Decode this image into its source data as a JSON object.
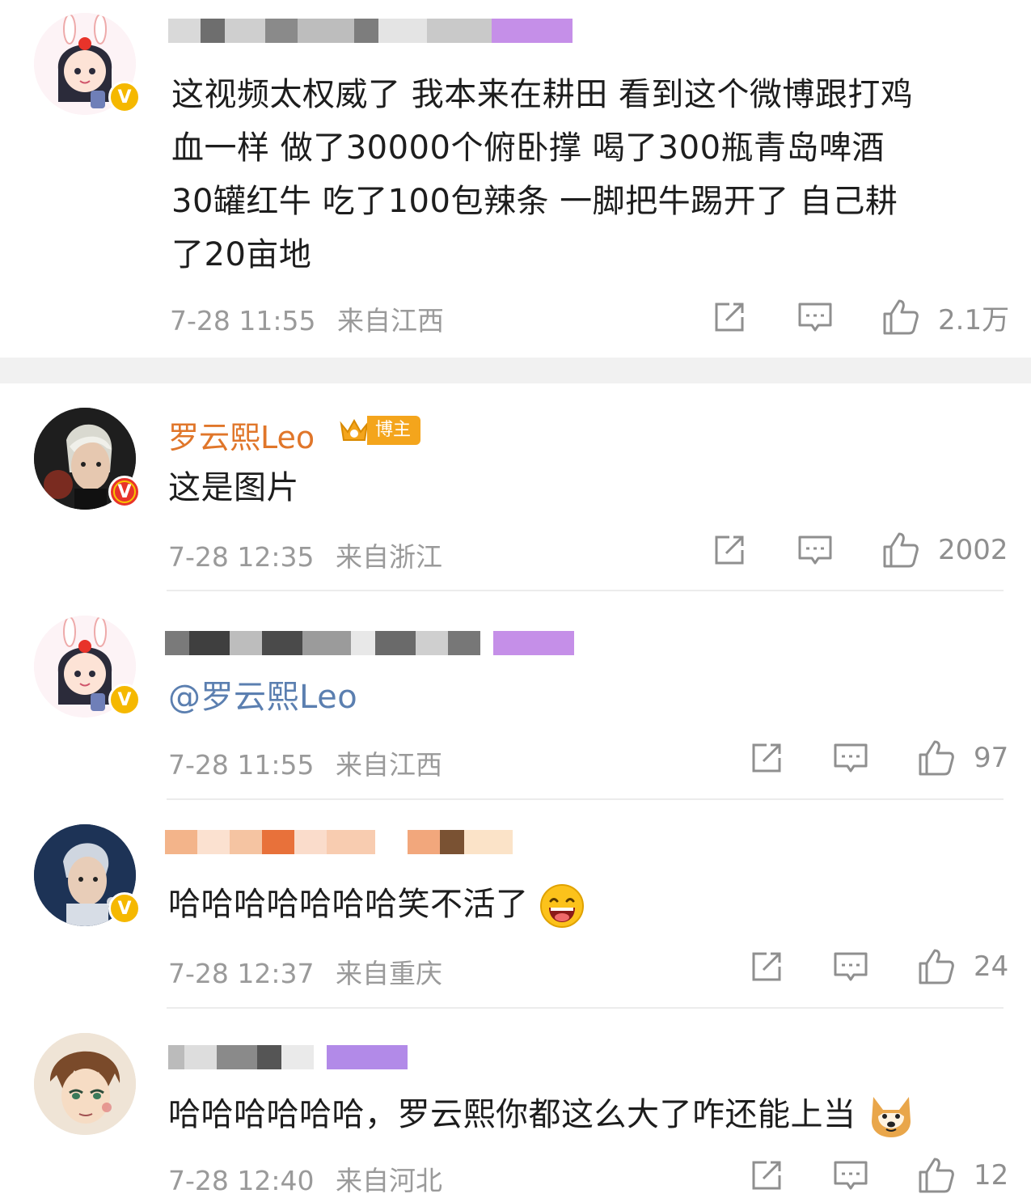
{
  "comments": [
    {
      "id": "c1",
      "text_lines": [
        "这视频太权威了 我本来在耕田 看到这个微博跟打鸡",
        "血一样 做了30000个俯卧撑 喝了300瓶青岛啤酒",
        " 30罐红牛 吃了100包辣条 一脚把牛踢开了 自己耕",
        "了20亩地"
      ],
      "time": "7-28 11:55",
      "location": "来自江西",
      "likes": "2.1万",
      "avatar_icon": "anime-girl-avatar",
      "badge": "gold-v-badge"
    },
    {
      "id": "c2",
      "username": "罗云熙Leo",
      "badge_label": "博主",
      "text": "这是图片",
      "time": "7-28 12:35",
      "location": "来自浙江",
      "likes": "2002",
      "avatar_icon": "man-portrait-avatar",
      "badge": "red-v-badge"
    },
    {
      "id": "c3",
      "text": "@罗云熙Leo",
      "time": "7-28 11:55",
      "location": "来自江西",
      "likes": "97",
      "avatar_icon": "anime-girl-avatar",
      "badge": "gold-v-badge"
    },
    {
      "id": "c4",
      "text": "哈哈哈哈哈哈哈笑不活了",
      "time": "7-28 12:37",
      "location": "来自重庆",
      "likes": "24",
      "avatar_icon": "man-portrait-avatar",
      "badge": "gold-v-badge"
    },
    {
      "id": "c5",
      "text": "哈哈哈哈哈哈，罗云熙你都这么大了咋还能上当",
      "time": "7-28 12:40",
      "location": "来自河北",
      "likes": "12",
      "avatar_icon": "anime-boy-avatar"
    }
  ],
  "colors": {
    "username": "#e0762a",
    "mention": "#5b7fb0",
    "meta": "#9a9a9a",
    "badge_gold": "#f5b800",
    "badge_red": "#e8332a",
    "boss_badge": "#f4a51c"
  }
}
